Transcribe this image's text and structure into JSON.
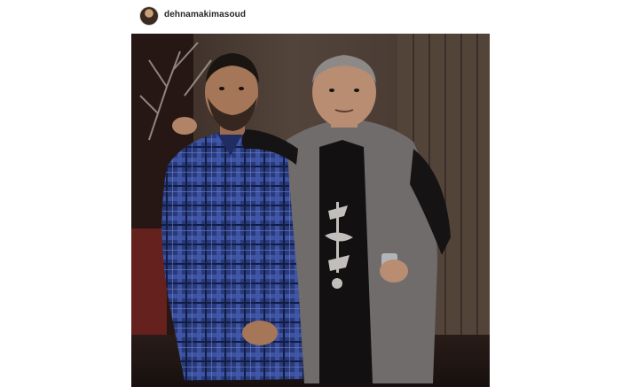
{
  "post": {
    "username": "dehnamakimasoud",
    "avatar_icon": "profile-avatar",
    "photo_icon": "photo-image"
  },
  "colors": {
    "background": "#ffffff",
    "username_text": "#262626"
  }
}
